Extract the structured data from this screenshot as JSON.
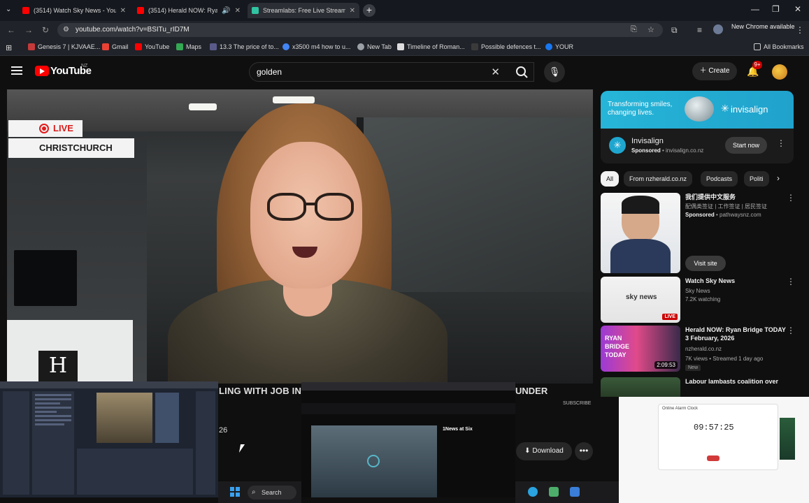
{
  "browser": {
    "tabs": [
      {
        "title": "(3514) Watch Sky News - YouT",
        "favicon": "youtube-icon",
        "color": "#ff0000"
      },
      {
        "title": "(3514) Herald NOW: Ryan B",
        "favicon": "youtube-icon",
        "color": "#ff0000"
      },
      {
        "title": "Streamlabs: Free Live Streamin",
        "favicon": "streamlabs-icon",
        "color": "#31c3a2"
      }
    ],
    "url": "youtube.com/watch?v=BSITu_rID7M",
    "update_label": "New Chrome available",
    "bookmarks": [
      {
        "label": "Genesis 7 | KJVAAE...",
        "color": "#c43a3a"
      },
      {
        "label": "Gmail",
        "color": "#e94235"
      },
      {
        "label": "YouTube",
        "color": "#ff0000"
      },
      {
        "label": "Maps",
        "color": "#34a853"
      },
      {
        "label": "13.3 The price of to...",
        "color": "#5a5a8a"
      },
      {
        "label": "x3500 m4 how to u...",
        "color": "#4285f4"
      },
      {
        "label": "New Tab",
        "color": "#9aa0a6"
      },
      {
        "label": "Timeline of Roman...",
        "color": "#dddddd"
      },
      {
        "label": "Possible defences t...",
        "color": "#3a3a3a"
      },
      {
        "label": "YOUR",
        "color": "#1877f2"
      }
    ],
    "all_bookmarks_label": "All Bookmarks"
  },
  "youtube": {
    "logo_text": "YouTube",
    "region": "NZ",
    "search_query": "golden",
    "create_label": "Create",
    "notification_count": "9+",
    "video": {
      "live_label": "LIVE",
      "location_label": "CHRISTCHURCH",
      "ticker_left": "LING WITH JOB IN",
      "ticker_right": "UNDER",
      "subscribe_label": "SUBSCRIBE",
      "partial_digits": "26",
      "herald_mark": "H"
    },
    "download_label": "Download",
    "ad": {
      "tagline": "Transforming smiles, changing lives.",
      "brand": "invisalign",
      "name": "Invisalign",
      "sponsored": "Sponsored",
      "domain": "invisalign.co.nz",
      "cta": "Start now"
    },
    "chips": [
      "All",
      "From nzherald.co.nz",
      "Podcasts",
      "Politi"
    ],
    "recommendations": [
      {
        "title": "我们提供中文服务",
        "subtitle": "配偶类签证 | 工作签证 | 居民签证",
        "sponsored": "Sponsored",
        "domain": "pathwaysnz.com",
        "cta": "Visit site"
      },
      {
        "title": "Watch Sky News",
        "channel": "Sky News",
        "meta": "7.2K watching",
        "badge": "LIVE",
        "logo": "sky news"
      },
      {
        "title": "Herald NOW: Ryan Bridge TODAY 3 February, 2026",
        "channel": "nzherald.co.nz",
        "meta": "7K views • Streamed 1 day ago",
        "badge": "New",
        "duration": "2:09:53",
        "thumb_text": "RYAN BRIDGE TODAY"
      },
      {
        "title": "Labour lambasts coalition over",
        "channel": "",
        "meta": ""
      }
    ]
  },
  "overlays": {
    "news_title": "1News at Six",
    "clock": "09:57:25",
    "alarm_title": "Online Alarm Clock"
  },
  "taskbar": {
    "search_label": "Search"
  }
}
